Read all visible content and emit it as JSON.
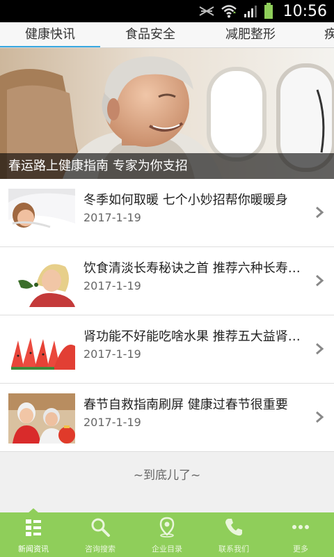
{
  "status_bar": {
    "time": "10:56"
  },
  "tabs": [
    {
      "label": "健康快讯",
      "active": true
    },
    {
      "label": "食品安全",
      "active": false
    },
    {
      "label": "减肥整形",
      "active": false
    },
    {
      "label": "疾",
      "active": false
    }
  ],
  "hero": {
    "caption": "春运路上健康指南 专家为你支招"
  },
  "news": [
    {
      "title": "冬季如何取暖 七个小妙招帮你暖暖身",
      "date": "2017-1-19"
    },
    {
      "title": "饮食清淡长寿秘诀之首 推荐六种长寿食物",
      "date": "2017-1-19"
    },
    {
      "title": "肾功能不好能吃啥水果 推荐五大益肾水果",
      "date": "2017-1-19"
    },
    {
      "title": "春节自救指南刷屏 健康过春节很重要",
      "date": "2017-1-19"
    }
  ],
  "end_text": "~到底儿了~",
  "bottom_nav": [
    {
      "label": "新闻资讯",
      "icon": "news-list-icon",
      "active": true
    },
    {
      "label": "咨询搜索",
      "icon": "search-icon",
      "active": false
    },
    {
      "label": "企业目录",
      "icon": "location-pin-icon",
      "active": false
    },
    {
      "label": "联系我们",
      "icon": "phone-icon",
      "active": false
    },
    {
      "label": "更多",
      "icon": "more-dots-icon",
      "active": false
    }
  ],
  "colors": {
    "tab_indicator": "#39a8e0",
    "bottom_nav_bg": "#8fce5a"
  }
}
